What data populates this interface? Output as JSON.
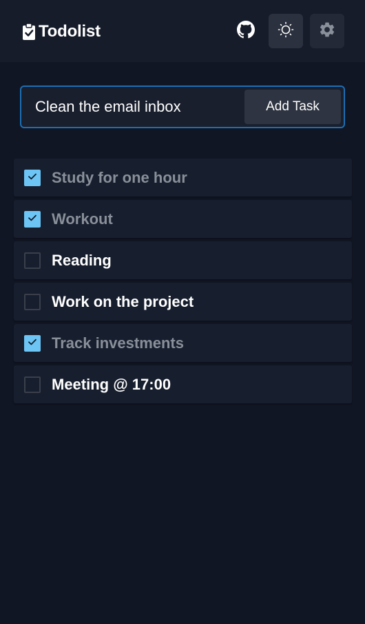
{
  "app": {
    "title": "Todolist",
    "brand_icon": "clipboard-check-icon",
    "accent_color": "#6cc5f5",
    "focus_border_color": "#1c6fb5"
  },
  "header": {
    "github_icon": "github-icon",
    "theme_icon": "sun-icon",
    "settings_icon": "gear-icon"
  },
  "add_form": {
    "input_value": "Clean the email inbox",
    "button_label": "Add Task"
  },
  "tasks": [
    {
      "label": "Study for one hour",
      "done": true
    },
    {
      "label": "Workout",
      "done": true
    },
    {
      "label": "Reading",
      "done": false
    },
    {
      "label": "Work on the project",
      "done": false
    },
    {
      "label": "Track investments",
      "done": true
    },
    {
      "label": "Meeting @ 17:00",
      "done": false
    }
  ]
}
